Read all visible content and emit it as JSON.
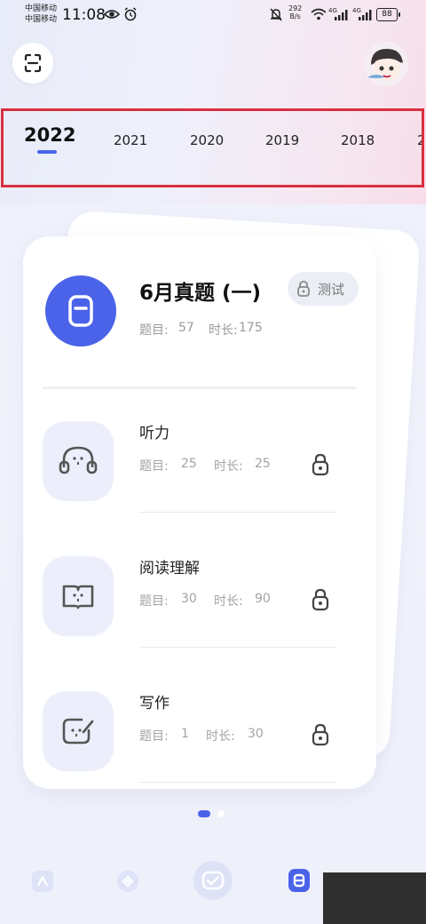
{
  "status_bar": {
    "carrier1": "中国移动",
    "carrier2": "中国移动",
    "time": "11:08",
    "net_speed_value": "292",
    "net_speed_unit": "B/s",
    "signal1_label": "4G",
    "signal2_label": "4G",
    "battery": "88"
  },
  "header": {
    "scan_icon": "scan-icon",
    "avatar_icon": "user-avatar"
  },
  "years": {
    "items": [
      "2022",
      "2021",
      "2020",
      "2019",
      "2018",
      "2"
    ],
    "selected": "2022"
  },
  "exam": {
    "title": "6月真题 (一)",
    "badge": "测试",
    "questions_label": "题目:",
    "questions": "57",
    "duration_label": "时长:",
    "duration": "175"
  },
  "sections": [
    {
      "name": "听力",
      "questions_label": "题目:",
      "questions": "25",
      "duration_label": "时长:",
      "duration": "25",
      "icon": "headphones-icon"
    },
    {
      "name": "阅读理解",
      "questions_label": "题目:",
      "questions": "30",
      "duration_label": "时长:",
      "duration": "90",
      "icon": "book-icon"
    },
    {
      "name": "写作",
      "questions_label": "题目:",
      "questions": "1",
      "duration_label": "时长:",
      "duration": "30",
      "icon": "write-icon"
    }
  ],
  "pager": {
    "pages": 2,
    "current": 1
  },
  "nav": {
    "items": [
      "home-icon",
      "explore-icon",
      "practice-icon",
      "papers-icon"
    ],
    "selected": "papers-icon"
  },
  "colors": {
    "accent": "#4a63e8",
    "highlight_border": "#d8303f"
  }
}
